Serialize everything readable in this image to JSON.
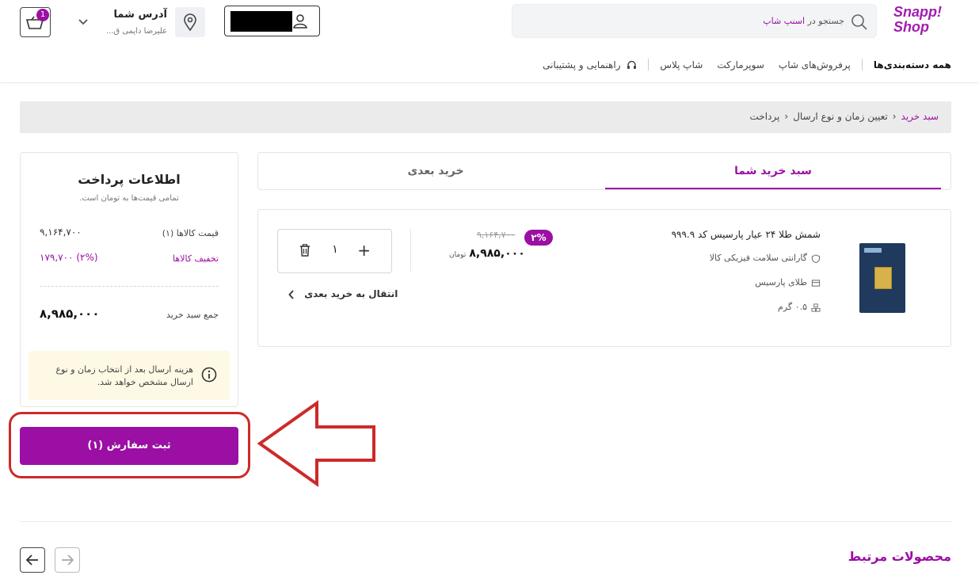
{
  "header": {
    "logo_line1": "Snapp!",
    "logo_line2": "Shop",
    "search": {
      "placeholder_prefix": "جستجو در",
      "placeholder_brand": "اسنپ شاپ"
    },
    "address": {
      "title": "آدرس شما",
      "subtitle": "علیرضا دایمی ق..."
    },
    "cart_badge": "1"
  },
  "nav": {
    "items": [
      "همه دسته‌بندی‌ها",
      "پرفروش‌های شاپ",
      "سوپرمارکت",
      "شاپ پلاس",
      "راهنمایی و پشتیبانی"
    ]
  },
  "breadcrumb": {
    "items": [
      "سبد خرید",
      "تعیین زمان و نوع ارسال",
      "پرداخت"
    ]
  },
  "tabs": {
    "active": "سبد خرید شما",
    "inactive": "خرید بعدی"
  },
  "product": {
    "title": "شمش طلا ۲۴ عیار پارسیس کد ۹۹۹.۹",
    "guarantee": "گارانتی سلامت فیزیکی کالا",
    "seller": "طلای پارسیس",
    "weight": "۰.۵ گرم",
    "discount_badge": "۲%",
    "old_price": "۹,۱۶۴,۷۰۰",
    "new_price": "۸,۹۸۵,۰۰۰",
    "currency": "تومان",
    "quantity": "۱",
    "move_to_later": "انتقال به خرید بعدی"
  },
  "payment": {
    "title": "اطلاعات پرداخت",
    "subtitle": "تمامی قیمت‌ها به تومان است.",
    "items_price_label": "قیمت کالاها (۱)",
    "items_price_value": "۹,۱۶۴,۷۰۰",
    "discount_label": "تخفیف کالاها",
    "discount_value": "(۲%) ۱۷۹,۷۰۰",
    "total_label": "جمع سبد خرید",
    "total_value": "۸,۹۸۵,۰۰۰",
    "notice": "هزینه ارسال بعد از انتخاب زمان و نوع ارسال مشخص خواهد شد."
  },
  "submit_label": "ثبت سفارش (۱)",
  "related_title": "محصولات مرتبط",
  "colors": {
    "accent": "#9b0fa4",
    "highlight_ring": "#cc2a2a",
    "notice_bg": "#fdf9e4"
  }
}
